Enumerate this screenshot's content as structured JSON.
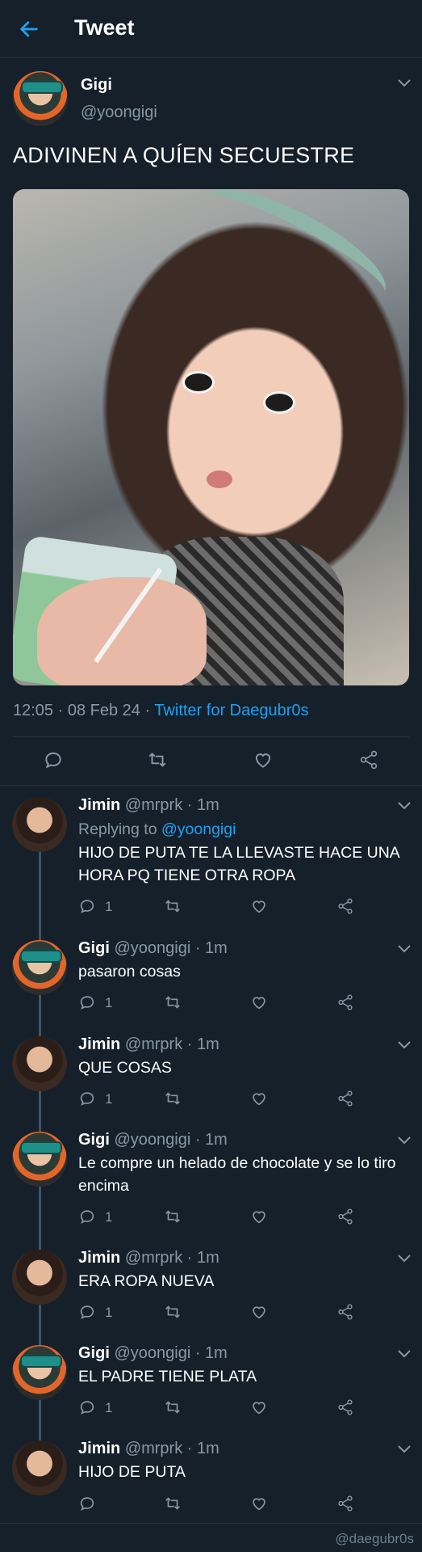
{
  "header": {
    "title": "Tweet",
    "back_icon": "back-arrow-icon"
  },
  "main_tweet": {
    "name": "Gigi",
    "handle": "@yoongigi",
    "text": "ADIVINEN A QUÍEN SECUESTRE",
    "time": "12:05 · 08 Feb 24 · ",
    "source": "Twitter for Daegubr0s"
  },
  "replies": [
    {
      "name": "Jimin",
      "handle_time": "@mrprk · 1m",
      "replying_label": "Replying to ",
      "replying_to": "@yoongigi",
      "text": "HIJO DE PUTA TE LA LLEVASTE HACE UNA HORA PQ TIENE OTRA ROPA",
      "reply_count": "1"
    },
    {
      "name": "Gigi",
      "handle_time": "@yoongigi · 1m",
      "text": "pasaron cosas",
      "reply_count": "1"
    },
    {
      "name": "Jimin",
      "handle_time": "@mrprk · 1m",
      "text": "QUE COSAS",
      "reply_count": "1"
    },
    {
      "name": "Gigi",
      "handle_time": "@yoongigi · 1m",
      "text": "Le compre un helado de chocolate y se lo tiro encima",
      "reply_count": "1"
    },
    {
      "name": "Jimin",
      "handle_time": "@mrprk · 1m",
      "text": "ERA ROPA NUEVA",
      "reply_count": "1"
    },
    {
      "name": "Gigi",
      "handle_time": "@yoongigi · 1m",
      "text": "EL PADRE TIENE PLATA",
      "reply_count": "1"
    },
    {
      "name": "Jimin",
      "handle_time": "@mrprk · 1m",
      "text": "HIJO DE PUTA",
      "reply_count": ""
    }
  ],
  "watermark": "@daegubr0s",
  "colors": {
    "background": "#15202b",
    "accent": "#1da1f2",
    "secondary_text": "#8899a6",
    "divider": "#253341"
  }
}
